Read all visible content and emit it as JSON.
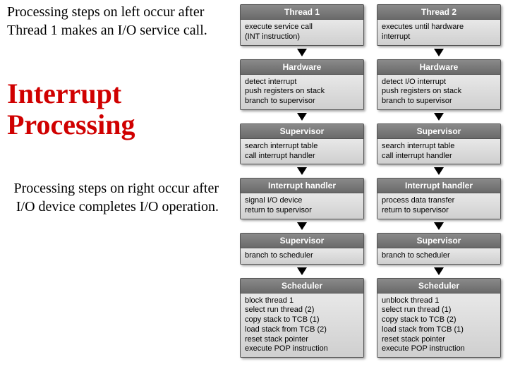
{
  "left": {
    "note_top": "Processing steps\non left\noccur after\nThread 1 makes an\nI/O service call.",
    "title": "Interrupt Processing",
    "note_bottom": "Processing steps\non right\noccur after\nI/O device completes\nI/O operation."
  },
  "columns": [
    {
      "id": "thread1",
      "boxes": [
        {
          "head": "Thread 1",
          "body": "execute service call\n(INT instruction)"
        },
        {
          "head": "Hardware",
          "body": "detect interrupt\npush registers on stack\nbranch to supervisor"
        },
        {
          "head": "Supervisor",
          "body": "search interrupt table\ncall interrupt handler"
        },
        {
          "head": "Interrupt handler",
          "body": "signal I/O device\nreturn to supervisor"
        },
        {
          "head": "Supervisor",
          "body": "branch to scheduler"
        },
        {
          "head": "Scheduler",
          "body": "block thread 1\nselect run thread (2)\ncopy stack to TCB (1)\nload stack from TCB (2)\nreset stack pointer\nexecute POP instruction"
        }
      ]
    },
    {
      "id": "thread2",
      "boxes": [
        {
          "head": "Thread 2",
          "body": "executes until hardware\ninterrupt"
        },
        {
          "head": "Hardware",
          "body": "detect I/O interrupt\npush registers on stack\nbranch to supervisor"
        },
        {
          "head": "Supervisor",
          "body": "search interrupt table\ncall interrupt handler"
        },
        {
          "head": "Interrupt handler",
          "body": "process data transfer\nreturn to supervisor"
        },
        {
          "head": "Supervisor",
          "body": "branch to scheduler"
        },
        {
          "head": "Scheduler",
          "body": "unblock thread 1\nselect run thread (1)\ncopy stack to TCB (2)\nload stack from TCB (1)\nreset stack pointer\nexecute POP instruction"
        }
      ]
    }
  ]
}
